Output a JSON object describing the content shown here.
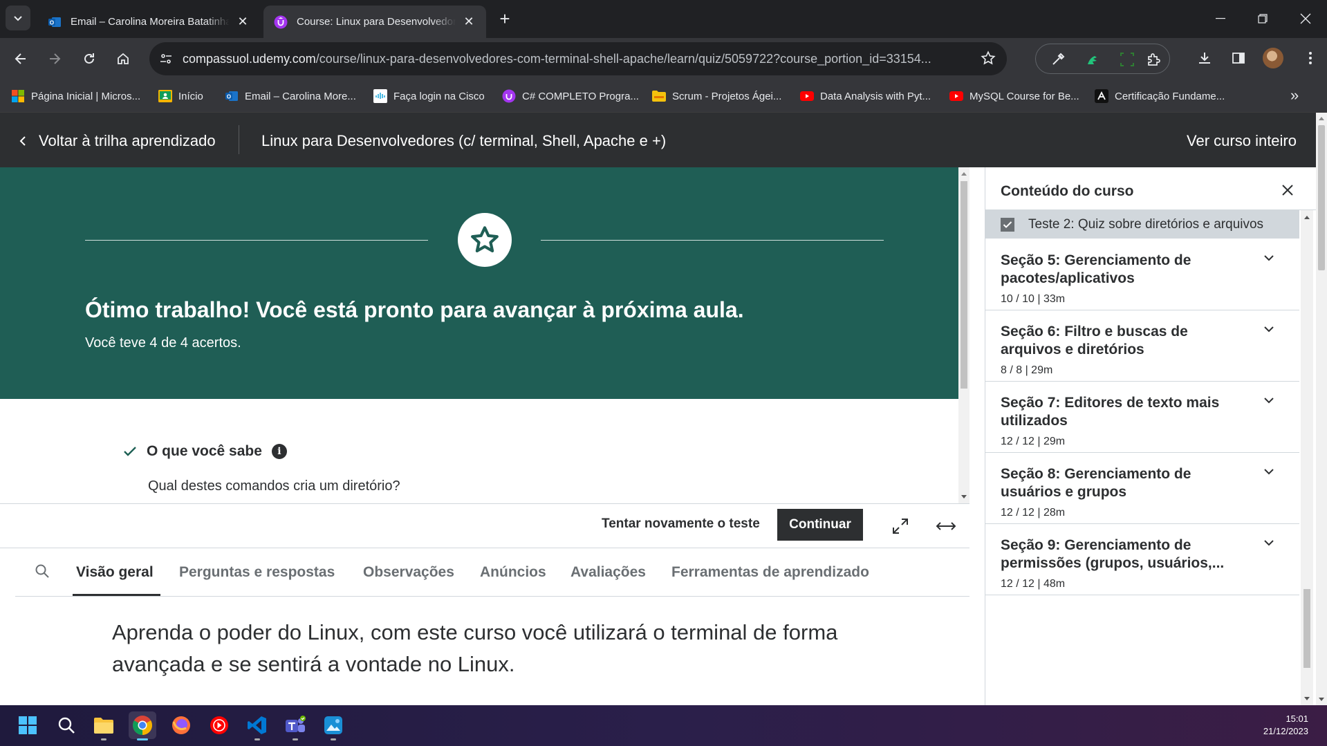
{
  "browser": {
    "tabs": [
      {
        "title": "Email – Carolina Moreira Batatinha",
        "active": false
      },
      {
        "title": "Course: Linux para Desenvolvedores",
        "active": true
      }
    ],
    "url_host": "compassuol.udemy.com",
    "url_path": "/course/linux-para-desenvolvedores-com-terminal-shell-apache/learn/quiz/5059722?course_portion_id=33154...",
    "bookmarks": [
      "Página Inicial | Micros...",
      "Início",
      "Email – Carolina More...",
      "Faça login na Cisco",
      "C# COMPLETO Progra...",
      "Scrum - Projetos Ágei...",
      "Data Analysis with Pyt...",
      "MySQL Course for Be...",
      "Certificação Fundame..."
    ]
  },
  "course_header": {
    "back_label": "Voltar à trilha aprendizado",
    "course_title": "Linux para Desenvolvedores (c/ terminal, Shell, Apache e +)",
    "see_all": "Ver curso inteiro"
  },
  "quiz_result": {
    "heading": "Ótimo trabalho! Você está pronto para avançar à próxima aula.",
    "score_text": "Você teve 4 de 4 acertos.",
    "knowledge_label": "O que você sabe",
    "info_glyph": "i",
    "question": "Qual destes comandos cria um diretório?"
  },
  "actions": {
    "retry": "Tentar novamente o teste",
    "continue": "Continuar"
  },
  "tabs": {
    "items": [
      {
        "label": "Visão geral",
        "active": true
      },
      {
        "label": "Perguntas e respostas",
        "active": false
      },
      {
        "label": "Observações",
        "active": false
      },
      {
        "label": "Anúncios",
        "active": false
      },
      {
        "label": "Avaliações",
        "active": false
      },
      {
        "label": "Ferramentas de aprendizado",
        "active": false
      }
    ]
  },
  "overview": {
    "text": "Aprenda o poder do Linux, com este curso você utilizará o terminal de forma avançada e se sentirá a vontade no Linux."
  },
  "sidebar": {
    "title": "Conteúdo do curso",
    "current_item": "Teste 2: Quiz sobre diretórios e arquivos",
    "sections": [
      {
        "title": "Seção 5: Gerenciamento de pacotes/aplicativos",
        "meta": "10 / 10 | 33m"
      },
      {
        "title": "Seção 6: Filtro e buscas de arquivos e diretórios",
        "meta": "8 / 8 | 29m"
      },
      {
        "title": "Seção 7: Editores de texto mais utilizados",
        "meta": "12 / 12 | 29m"
      },
      {
        "title": "Seção 8: Gerenciamento de usuários e grupos",
        "meta": "12 / 12 | 28m"
      },
      {
        "title": "Seção 9: Gerenciamento de permissões (grupos, usuários,...",
        "meta": "12 / 12 | 48m"
      }
    ]
  },
  "taskbar": {
    "time": "15:01",
    "date": "21/12/2023"
  },
  "colors": {
    "banner": "#1f5e55",
    "udemy_dark": "#2d2f31",
    "accent_check": "#1e6055"
  }
}
